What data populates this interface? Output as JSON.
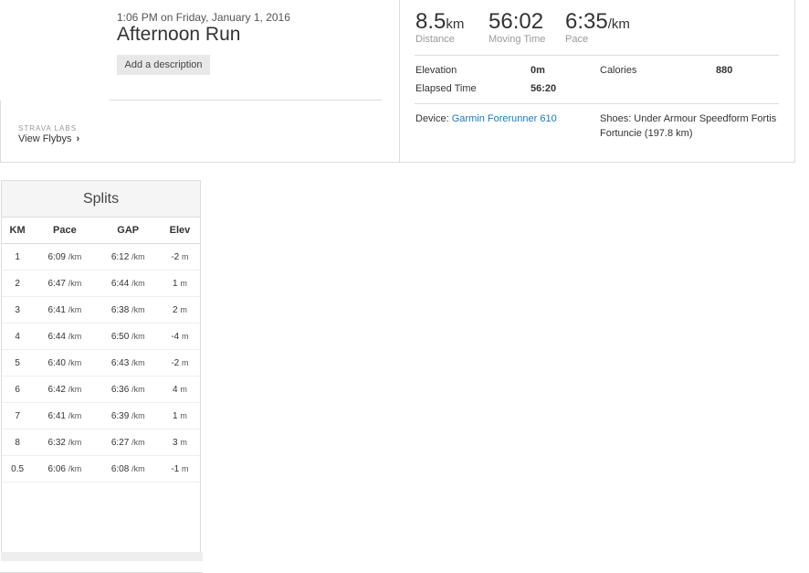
{
  "activity": {
    "meta": "1:06 PM on Friday, January 1, 2016",
    "title": "Afternoon Run",
    "add_description": "Add a description"
  },
  "labs": {
    "label": "STRAVA LABS",
    "flybys": "View Flybys",
    "flybys_chevron": "›"
  },
  "stats": {
    "distance": {
      "value": "8.5",
      "unit": "km",
      "label": "Distance"
    },
    "moving_time": {
      "value": "56:02",
      "label": "Moving Time"
    },
    "pace": {
      "value": "6:35",
      "unit": "/km",
      "label": "Pace"
    }
  },
  "details": {
    "elevation_label": "Elevation",
    "elevation_value": "0m",
    "calories_label": "Calories",
    "calories_value": "880",
    "elapsed_label": "Elapsed Time",
    "elapsed_value": "56:20"
  },
  "gear": {
    "device_label": "Device:",
    "device_name": "Garmin Forerunner 610",
    "shoes_line1": "Shoes: Under Armour Speedform Fortis",
    "shoes_line2": "Fortuncie (197.8 km)"
  },
  "splits": {
    "title": "Splits",
    "headers": [
      "KM",
      "Pace",
      "GAP",
      "Elev"
    ],
    "pace_unit": "/km",
    "elev_unit": "m",
    "rows": [
      {
        "km": "1",
        "pace": "6:09",
        "gap": "6:12",
        "elev": "-2"
      },
      {
        "km": "2",
        "pace": "6:47",
        "gap": "6:44",
        "elev": "1"
      },
      {
        "km": "3",
        "pace": "6:41",
        "gap": "6:38",
        "elev": "2"
      },
      {
        "km": "4",
        "pace": "6:44",
        "gap": "6:50",
        "elev": "-4"
      },
      {
        "km": "5",
        "pace": "6:40",
        "gap": "6:43",
        "elev": "-2"
      },
      {
        "km": "6",
        "pace": "6:42",
        "gap": "6:36",
        "elev": "4"
      },
      {
        "km": "7",
        "pace": "6:41",
        "gap": "6:39",
        "elev": "1"
      },
      {
        "km": "8",
        "pace": "6:32",
        "gap": "6:27",
        "elev": "3"
      },
      {
        "km": "0.5",
        "pace": "6:06",
        "gap": "6:08",
        "elev": "-1"
      }
    ]
  }
}
